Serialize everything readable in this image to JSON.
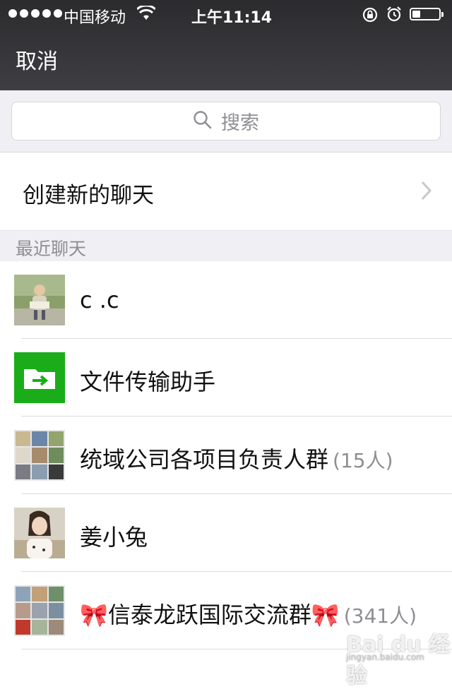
{
  "status_bar": {
    "carrier": "中国移动",
    "time": "上午11:14",
    "battery_level": 0.3
  },
  "nav": {
    "cancel_label": "取消"
  },
  "search": {
    "placeholder": "搜索"
  },
  "create_chat": {
    "label": "创建新的聊天"
  },
  "section": {
    "title": "最近聊天"
  },
  "chats": [
    {
      "name": "c .c",
      "count": "",
      "avatar": "photo-child-reading"
    },
    {
      "name": "文件传输助手",
      "count": "",
      "avatar": "file-transfer-icon"
    },
    {
      "name": "统域公司各项目负责人群",
      "count": "(15人)",
      "avatar": "group-collage"
    },
    {
      "name": "姜小兔",
      "count": "",
      "avatar": "photo-woman"
    },
    {
      "name": "🎀信泰龙跃国际交流群🎀",
      "count": "(341人)",
      "avatar": "group-collage"
    }
  ],
  "watermark": {
    "text": "Bai du 经验",
    "sub": "jingyan.baidu.com"
  },
  "colors": {
    "nav_bg": "#3a3a3d",
    "section_bg": "#efeff4",
    "file_transfer_green": "#1aad19",
    "secondary_text": "#8e8e93"
  }
}
